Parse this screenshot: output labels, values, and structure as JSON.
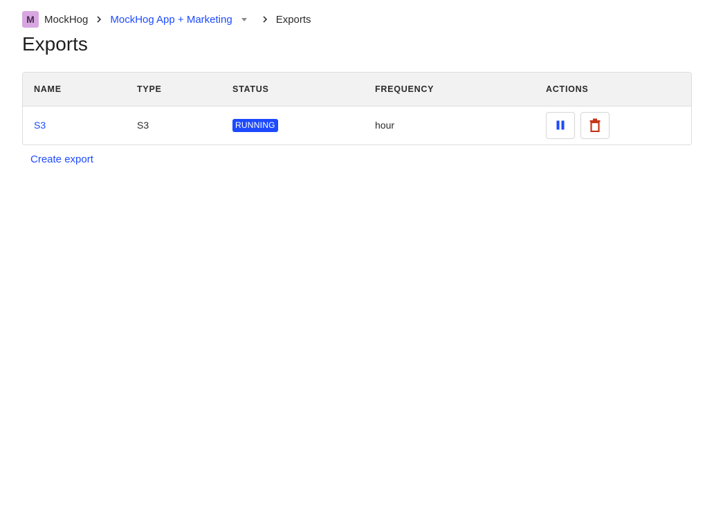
{
  "breadcrumb": {
    "org_initial": "M",
    "org_name": "MockHog",
    "project_name": "MockHog App + Marketing",
    "current": "Exports"
  },
  "page_title": "Exports",
  "table": {
    "columns": [
      "NAME",
      "TYPE",
      "STATUS",
      "FREQUENCY",
      "ACTIONS"
    ],
    "rows": [
      {
        "name": "S3",
        "type": "S3",
        "status": "RUNNING",
        "frequency": "hour",
        "actions": [
          "pause-icon",
          "trash-icon"
        ]
      }
    ]
  },
  "create_export_label": "Create export",
  "colors": {
    "accent": "#1d4aff",
    "danger": "#c8341a",
    "avatar_bg": "#d8a6e0"
  }
}
